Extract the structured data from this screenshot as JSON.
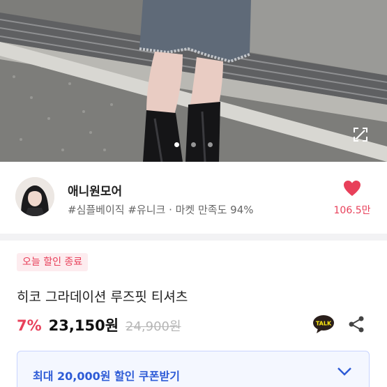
{
  "gallery": {
    "image": "denim-shorts-black-boots-photo",
    "current_index": 1,
    "total": 3,
    "expand_icon": "expand-icon"
  },
  "seller": {
    "name": "애니원모어",
    "tags": "#심플베이직 #유니크 · 마켓 만족도 94%",
    "likes": "106.5만",
    "like_icon": "heart-icon",
    "like_color": "#e8405a"
  },
  "product": {
    "badge": "오늘 할인 종료",
    "title": "히코 그라데이션 루즈핏 티셔츠",
    "discount": "7%",
    "price": "23,150원",
    "original_price": "24,900원",
    "talk_label": "TALK",
    "share_icon": "share-icon"
  },
  "coupon": {
    "label": "최대 20,000원 할인 쿠폰받기",
    "chevron_icon": "chevron-down-icon"
  },
  "colors": {
    "accent": "#e8405a",
    "coupon_blue": "#2d5bd6"
  }
}
